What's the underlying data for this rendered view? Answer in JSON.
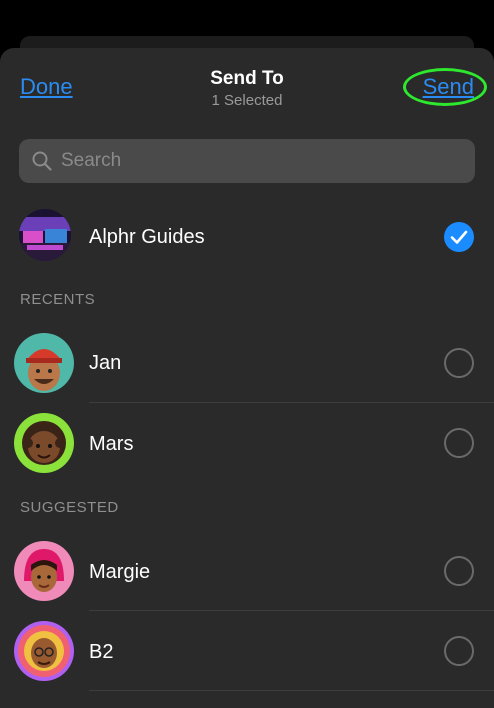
{
  "header": {
    "done_label": "Done",
    "title": "Send To",
    "subtitle": "1 Selected",
    "send_label": "Send"
  },
  "search": {
    "placeholder": "Search"
  },
  "selected_group": {
    "name": "Alphr Guides",
    "checked": true
  },
  "recents": {
    "label": "RECENTS",
    "items": [
      {
        "name": "Jan",
        "checked": false
      },
      {
        "name": "Mars",
        "checked": false
      }
    ]
  },
  "suggested": {
    "label": "SUGGESTED",
    "items": [
      {
        "name": "Margie",
        "checked": false
      },
      {
        "name": "B2",
        "checked": false
      }
    ]
  },
  "colors": {
    "accent": "#2a8cf3",
    "highlight_ring": "#2ee82e",
    "checked": "#1a8cff",
    "sheet_bg": "#2a2a2a"
  }
}
